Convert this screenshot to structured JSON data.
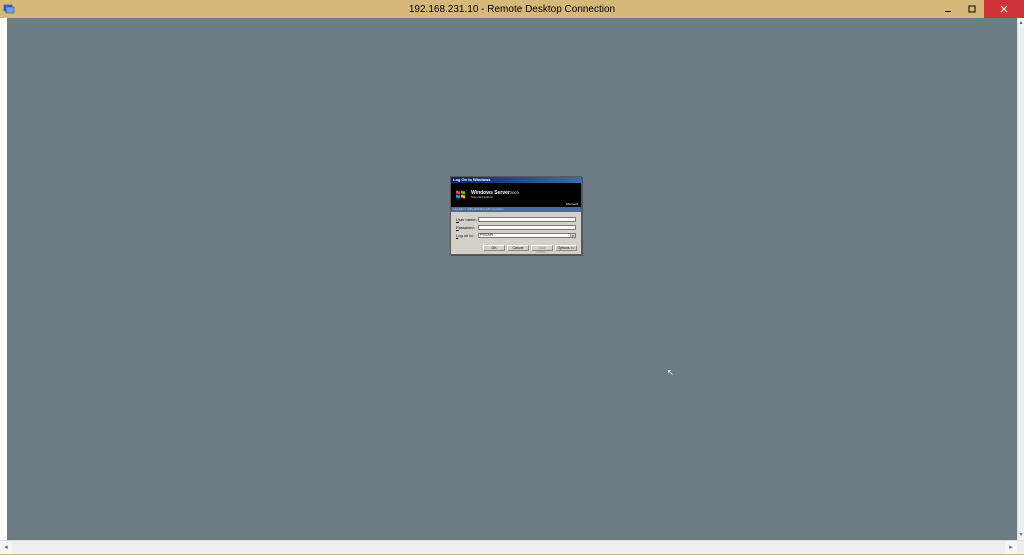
{
  "window": {
    "title": "192.168.231.10 - Remote Desktop Connection"
  },
  "login": {
    "dialog_title": "Log On to Windows",
    "brand_line1": "Windows Server",
    "brand_year": "2003",
    "brand_line2": "Standard Edition",
    "brand_ms": "Microsoft",
    "copyright": "Copyright © 1985-2003 Microsoft Corporation",
    "labels": {
      "username": "User name:",
      "password": "Password:",
      "logonto": "Log on to:"
    },
    "values": {
      "username": "",
      "password": "",
      "logonto": "PSGAPI"
    },
    "buttons": {
      "ok": "OK",
      "cancel": "Cancel",
      "shutdown": "Shut Down...",
      "options": "Options <<"
    }
  }
}
